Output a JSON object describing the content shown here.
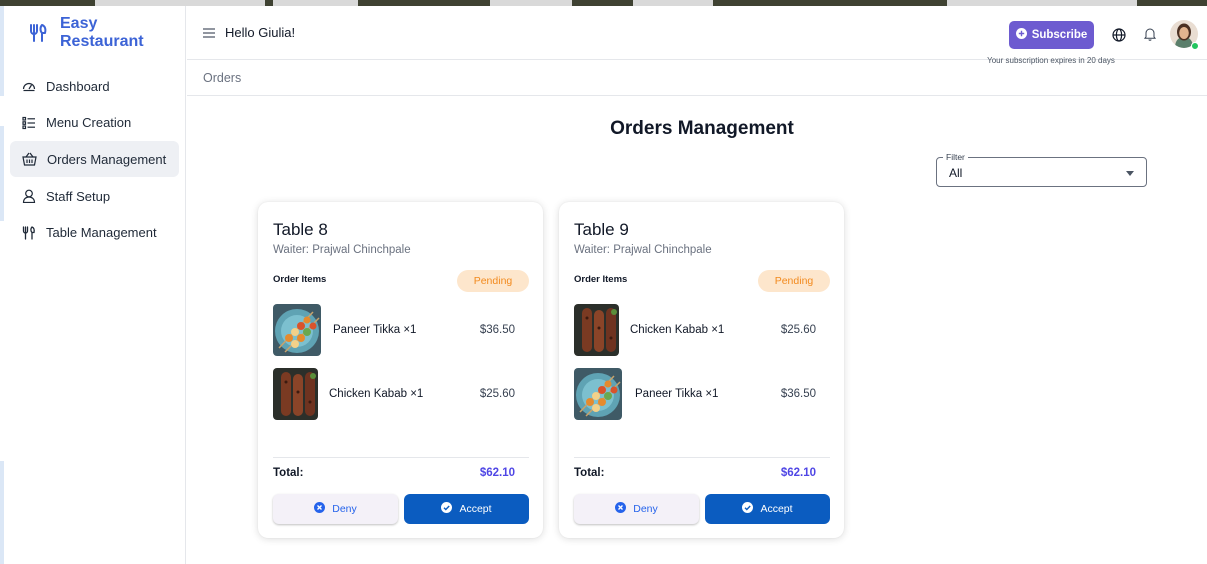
{
  "app": {
    "name": "Easy Restaurant"
  },
  "colors": {
    "brand": "#3c63d6",
    "subscribe": "#6d5bd0",
    "accept": "#0b5cc0",
    "pending_bg": "#fde6cc",
    "pending_text": "#f28a1e",
    "total": "#4f46e5",
    "online": "#22c55e"
  },
  "sidebar": {
    "items": [
      {
        "label": "Dashboard",
        "icon": "dashboard-icon"
      },
      {
        "label": "Menu Creation",
        "icon": "list-icon"
      },
      {
        "label": "Orders Management",
        "icon": "basket-icon",
        "active": true
      },
      {
        "label": "Staff Setup",
        "icon": "user-icon"
      },
      {
        "label": "Table Management",
        "icon": "utensils-icon"
      }
    ]
  },
  "header": {
    "greeting": "Hello Giulia!",
    "subscribe_label": "Subscribe",
    "subscription_note": "Your subscription expires in 20 days"
  },
  "breadcrumb": {
    "current": "Orders"
  },
  "main": {
    "title": "Orders Management",
    "filter": {
      "label": "Filter",
      "value": "All"
    }
  },
  "orders": [
    {
      "table": "Table 8",
      "waiter": "Waiter: Prajwal Chinchpale",
      "items_label": "Order Items",
      "status": "Pending",
      "items": [
        {
          "name": "Paneer Tikka ×1",
          "price": "$36.50",
          "image": "paneer-tikka"
        },
        {
          "name": "Chicken Kabab ×1",
          "price": "$25.60",
          "image": "chicken-kabab"
        }
      ],
      "total_label": "Total:",
      "total": "$62.10",
      "deny_label": "Deny",
      "accept_label": "Accept"
    },
    {
      "table": "Table 9",
      "waiter": "Waiter: Prajwal Chinchpale",
      "items_label": "Order Items",
      "status": "Pending",
      "items": [
        {
          "name": "Chicken Kabab ×1",
          "price": "$25.60",
          "image": "chicken-kabab"
        },
        {
          "name": "Paneer Tikka ×1",
          "price": "$36.50",
          "image": "paneer-tikka"
        }
      ],
      "total_label": "Total:",
      "total": "$62.10",
      "deny_label": "Deny",
      "accept_label": "Accept"
    }
  ]
}
